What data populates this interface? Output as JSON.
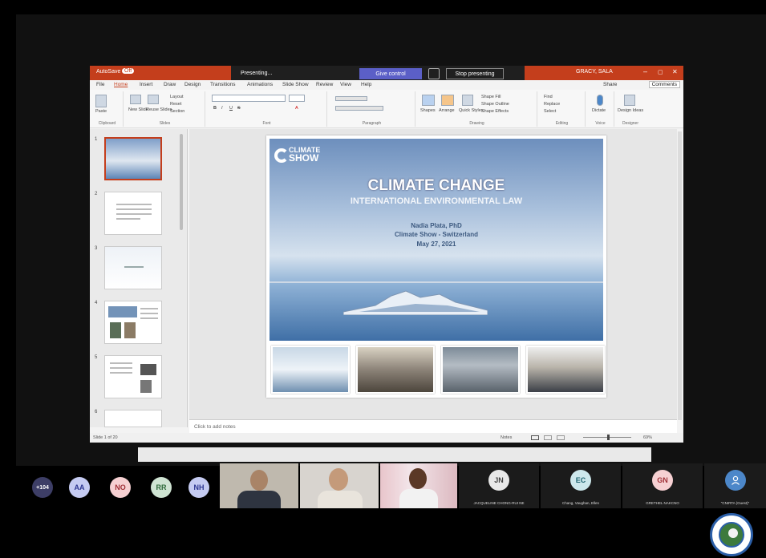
{
  "app": {
    "autosave_label": "AutoSave",
    "autosave_state": "Off",
    "user_name": "GRACY, SALA",
    "presenting_label": "Presenting...",
    "give_control_label": "Give control",
    "stop_presenting_label": "Stop presenting"
  },
  "tabs": [
    "File",
    "Home",
    "Insert",
    "Draw",
    "Design",
    "Transitions",
    "Animations",
    "Slide Show",
    "Review",
    "View",
    "Help"
  ],
  "share_label": "Share",
  "comments_label": "Comments",
  "ribbon": {
    "groups": [
      {
        "label": "Clipboard",
        "items": [
          "Paste"
        ]
      },
      {
        "label": "Slides",
        "items": [
          "New Slide",
          "Reuse Slides",
          "Layout",
          "Reset",
          "Section"
        ]
      },
      {
        "label": "Font",
        "items": [
          "B",
          "I",
          "U",
          "S",
          "A"
        ]
      },
      {
        "label": "Paragraph",
        "items": []
      },
      {
        "label": "Drawing",
        "items": [
          "Shapes",
          "Arrange",
          "Quick Styles",
          "Shape Fill",
          "Shape Outline",
          "Shape Effects"
        ]
      },
      {
        "label": "Editing",
        "items": [
          "Find",
          "Replace",
          "Select"
        ]
      },
      {
        "label": "Voice",
        "items": [
          "Dictate"
        ]
      },
      {
        "label": "Designer",
        "items": [
          "Design Ideas"
        ]
      }
    ]
  },
  "thumbnails": [
    {
      "num": "1"
    },
    {
      "num": "2"
    },
    {
      "num": "3"
    },
    {
      "num": "4"
    },
    {
      "num": "5"
    },
    {
      "num": "6"
    }
  ],
  "slide": {
    "logo_line1": "CLIMATE",
    "logo_line2": "SHOW",
    "title": "CLIMATE CHANGE",
    "subtitle": "INTERNATIONAL ENVIRONMENTAL LAW",
    "presenter": "Nadia Plata, PhD",
    "org": "Climate Show - Switzerland",
    "date": "May 27, 2021"
  },
  "notes_placeholder": "Click to add notes",
  "status": {
    "slide_count": "Slide 1 of 20",
    "notes_label": "Notes",
    "zoom": "69%"
  },
  "participants": {
    "overflow_count": "+104",
    "avatars": [
      {
        "initials": "AA",
        "bg": "#c5cbf2",
        "fg": "#2c3590"
      },
      {
        "initials": "NO",
        "bg": "#f6d0d2",
        "fg": "#a03037"
      },
      {
        "initials": "RR",
        "bg": "#cfe4d3",
        "fg": "#2f6a3b"
      },
      {
        "initials": "NH",
        "bg": "#c5cbf2",
        "fg": "#2c3590"
      }
    ],
    "tiles": [
      {
        "initials": "JN",
        "name": "JACQUELINE CHONG-RUI NE",
        "bg": "#e8e8e8",
        "fg": "#444"
      },
      {
        "initials": "EC",
        "name": "Chang, Vaughan, Ellen",
        "bg": "#cde8ec",
        "fg": "#1e6470"
      },
      {
        "initials": "GN",
        "name": "GRETHEL NAKCNO",
        "bg": "#f6d0d2",
        "fg": "#a03037"
      },
      {
        "initials": "",
        "name": "\"CNIRTA (Guest)\"",
        "bg": "#4c87c9",
        "fg": "#fff"
      }
    ]
  }
}
